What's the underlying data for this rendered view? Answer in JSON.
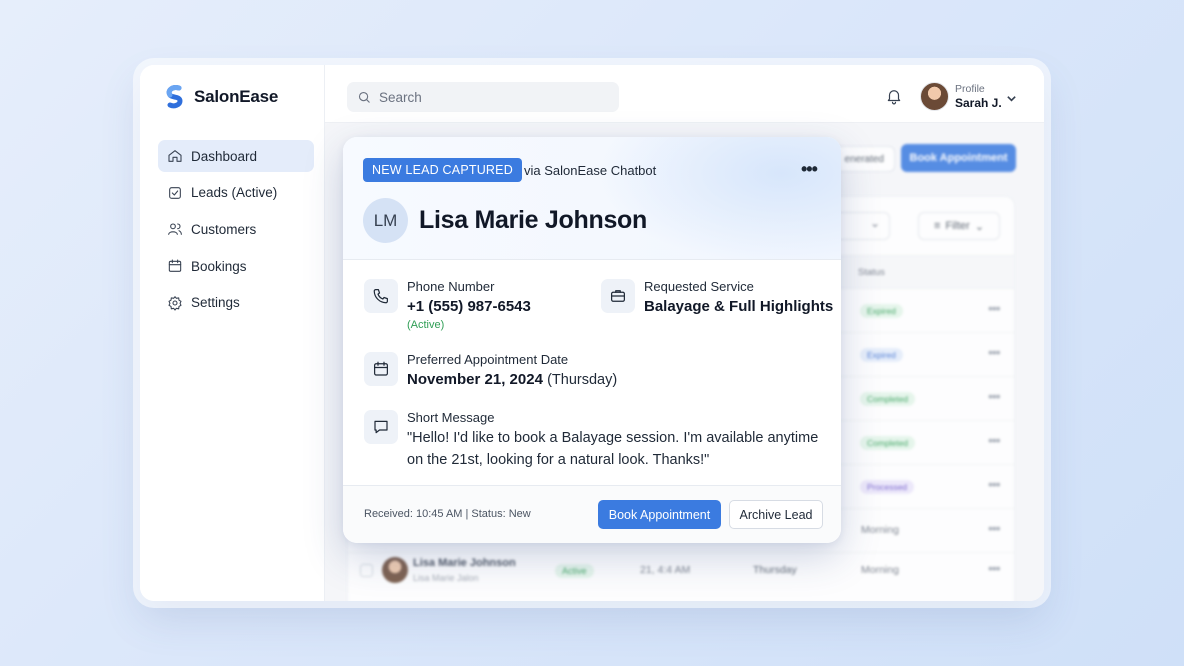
{
  "app": {
    "name": "SalonEase"
  },
  "sidebar": {
    "items": [
      {
        "label": "Dashboard",
        "icon": "home-icon",
        "active": true
      },
      {
        "label": "Leads (Active)",
        "icon": "checkbox-icon",
        "active": false
      },
      {
        "label": "Customers",
        "icon": "users-icon",
        "active": false
      },
      {
        "label": "Bookings",
        "icon": "calendar-icon",
        "active": false
      },
      {
        "label": "Settings",
        "icon": "gear-icon",
        "active": false
      }
    ]
  },
  "header": {
    "search_placeholder": "Search",
    "profile_label": "Profile",
    "profile_name": "Sarah J."
  },
  "background": {
    "generated_label": "enerated",
    "book_label": "Book Appointment",
    "filter_label": "Filter",
    "status_header": "Status",
    "rows": [
      {
        "status": "Expired",
        "kind": "green"
      },
      {
        "status": "Expired",
        "kind": "blue"
      },
      {
        "status": "Completed",
        "kind": "green"
      },
      {
        "status": "Completed",
        "kind": "green"
      },
      {
        "status": "Processed",
        "kind": "purple"
      },
      {
        "status": "Morning",
        "kind": "text"
      }
    ],
    "last_row": {
      "name": "Lisa Marie Johnson",
      "sub": "Lisa Marie Jalon",
      "status": "Active",
      "date": "21, 4:4 AM",
      "day": "Thursday",
      "time": "Morning"
    }
  },
  "lead": {
    "tag": "NEW LEAD CAPTURED",
    "source": "via SalonEase Chatbot",
    "initials": "LM",
    "name": "Lisa Marie Johnson",
    "phone_label": "Phone Number",
    "phone_value": "+1 (555) 987-6543",
    "phone_note": "(Active)",
    "service_label": "Requested Service",
    "service_value": "Balayage & Full Highlights",
    "date_label": "Preferred Appointment Date",
    "date_value": "November 21, 2024",
    "date_day": "(Thursday)",
    "message_label": "Short Message",
    "message_value": "\"Hello! I'd like to book a Balayage session. I'm available anytime on the 21st, looking for a natural look. Thanks!\"",
    "received": "Received: 10:45 AM | Status: New",
    "book_label": "Book Appointment",
    "archive_label": "Archive Lead"
  },
  "colors": {
    "accent": "#3b7be0",
    "active_green": "#2f9e55"
  }
}
